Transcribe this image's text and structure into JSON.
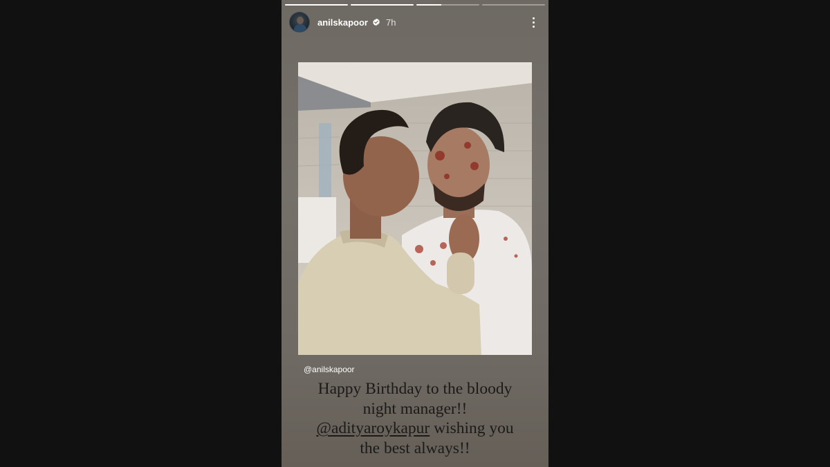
{
  "story": {
    "progress": [
      1,
      1,
      0.4,
      0
    ],
    "header": {
      "username": "anilskapoor",
      "time": "7h",
      "verified_icon": "verified-badge-icon",
      "more_icon": "more-vertical-icon"
    },
    "repost_mention": "@anilskapoor",
    "caption": {
      "line1": "Happy Birthday to the bloody",
      "line2": "night manager!!",
      "tag": "@adityaroykapur",
      "line3_rest": " wishing you",
      "line4": "the best always!!"
    }
  },
  "colors": {
    "page_bg": "#111111",
    "story_bg": "#6e6a63",
    "caption_text": "#1c1a17"
  }
}
